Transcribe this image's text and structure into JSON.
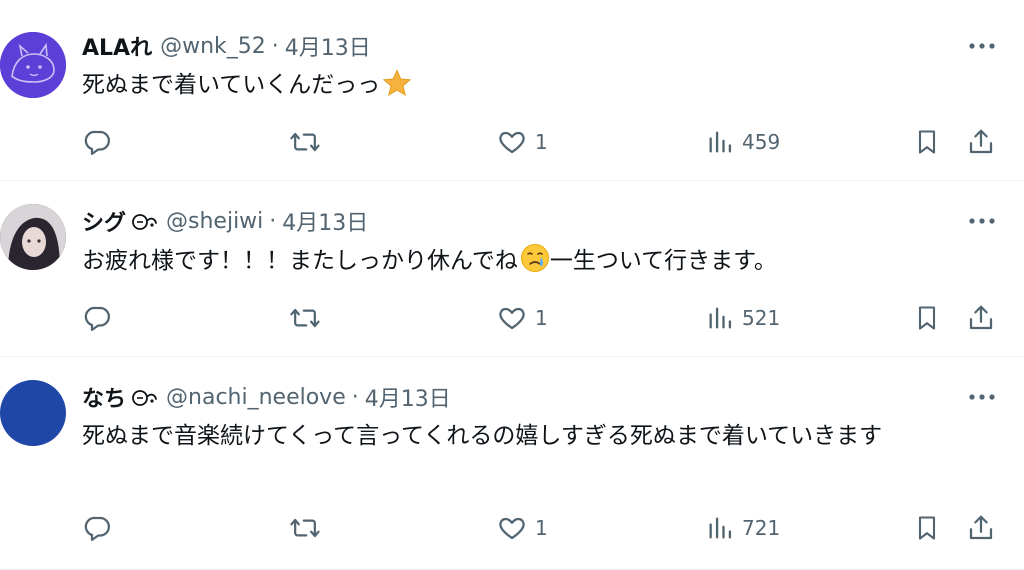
{
  "tweets": [
    {
      "display_name": "ALAれ",
      "handle": "@wnk_52",
      "separator": "·",
      "date": "4月13日",
      "text": "死ぬまで着いていくんだっっ",
      "emoji": "star-emoji",
      "avatar_color": "#5b3fd6",
      "likes": "1",
      "views": "459"
    },
    {
      "display_name": "シグ",
      "handle": "@shejiwi",
      "separator": "·",
      "date": "4月13日",
      "text_before": "お疲れ様です！！！またしっかり休んでね",
      "emoji": "crying-face-emoji",
      "text_after": "一生ついて行きます。",
      "avatar_color": "#2b2530",
      "likes": "1",
      "views": "521"
    },
    {
      "display_name": "なち",
      "handle": "@nachi_neelove",
      "separator": "·",
      "date": "4月13日",
      "text": "死ぬまで音楽続けてくって言ってくれるの嬉しすぎる死ぬまで着いていきます",
      "avatar_color": "#1f47a8",
      "likes": "1",
      "views": "721"
    }
  ],
  "colors": {
    "muted": "#536471",
    "text": "#0f1419",
    "divider": "#eff3f4"
  },
  "icons": [
    "reply-icon",
    "retweet-icon",
    "heart-icon",
    "views-icon",
    "bookmark-icon",
    "share-icon",
    "more-icon"
  ]
}
